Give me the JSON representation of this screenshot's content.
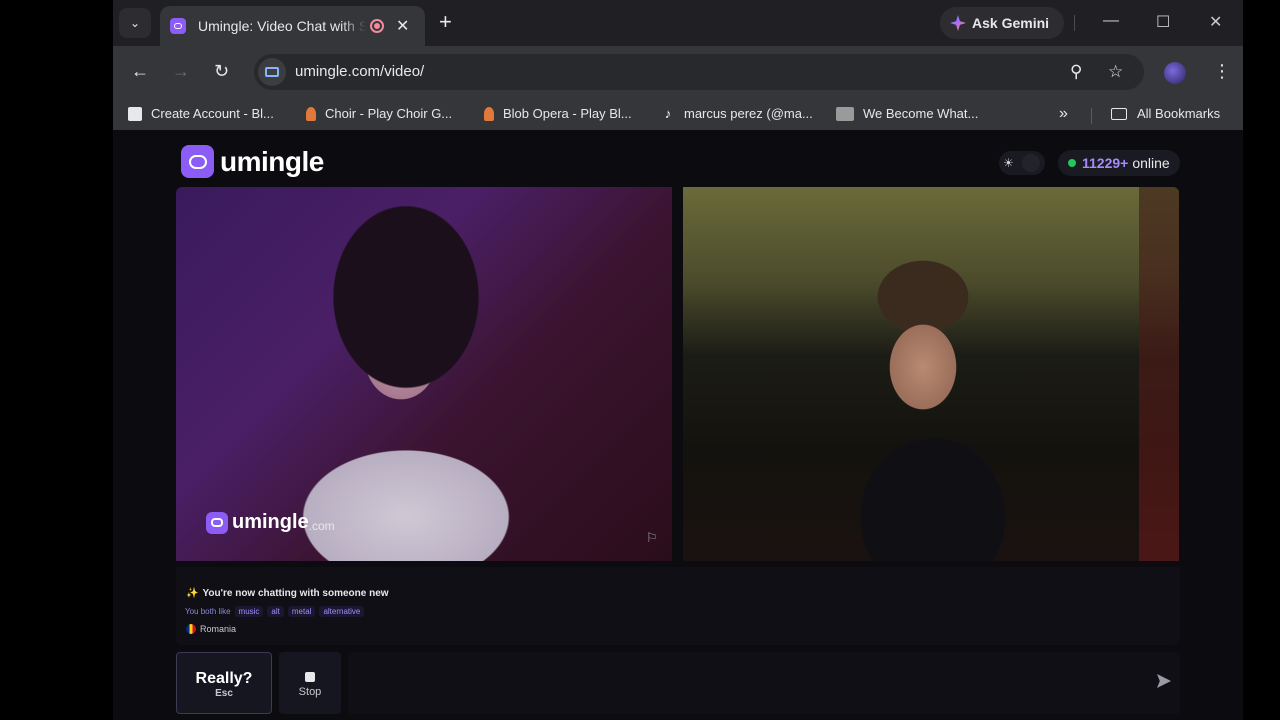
{
  "browser": {
    "tab": {
      "title": "Umingle: Video Chat with Strangers"
    },
    "gemini_label": "Ask Gemini",
    "url": "umingle.com/video/",
    "bookmarks": [
      {
        "label": "Create Account - Bl...",
        "icon": "blooket-icon",
        "color": "#e8e8ea"
      },
      {
        "label": "Choir - Play Choir G...",
        "icon": "choir-figure-icon",
        "color": "#e0793a"
      },
      {
        "label": "Blob Opera - Play Bl...",
        "icon": "blob-opera-figure-icon",
        "color": "#e0793a"
      },
      {
        "label": "marcus perez (@ma...",
        "icon": "tiktok-icon",
        "color": "#ffffff"
      },
      {
        "label": "We Become What...",
        "icon": "game-thumbnail-icon",
        "color": "#bdbdbd"
      }
    ],
    "all_bookmarks_label": "All Bookmarks"
  },
  "page": {
    "brand": "umingle",
    "online": {
      "count": "11229+",
      "label": "online"
    },
    "watermark": {
      "name": "umingle",
      "tld": ".com"
    },
    "chat": {
      "notice": "You're now chatting with someone new",
      "likes_label": "You both like",
      "interests": [
        "music",
        "alt",
        "metal",
        "alternative"
      ],
      "country": "Romania"
    },
    "controls": {
      "esc_label": "Really?",
      "esc_key": "Esc",
      "stop_label": "Stop",
      "message_placeholder": ""
    }
  },
  "colors": {
    "accent": "#8b5cf6",
    "online_dot": "#22c55e",
    "count": "#a78bfa"
  }
}
